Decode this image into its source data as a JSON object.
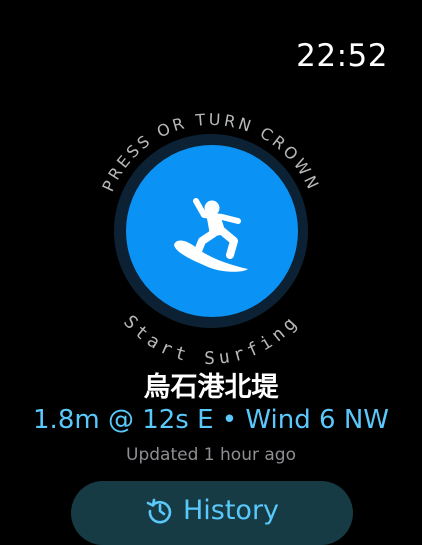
{
  "status": {
    "time": "22:52"
  },
  "dial": {
    "top_hint": "PRESS OR TURN CROWN",
    "bottom_hint": "Start Surfing",
    "icon": "surfer-icon",
    "colors": {
      "button": "#0A93F5",
      "ring": "#0C2234",
      "hint_text": "#B8B8B8"
    }
  },
  "spot": {
    "name": "烏石港北堤",
    "conditions": "1.8m @ 12s E • Wind 6 NW",
    "updated": "Updated 1 hour ago"
  },
  "history": {
    "label": "History",
    "icon": "history-clock-icon"
  },
  "colors": {
    "accent": "#5AC8FA",
    "secondary_text": "#8E8E93",
    "history_button_bg": "#163B44"
  }
}
